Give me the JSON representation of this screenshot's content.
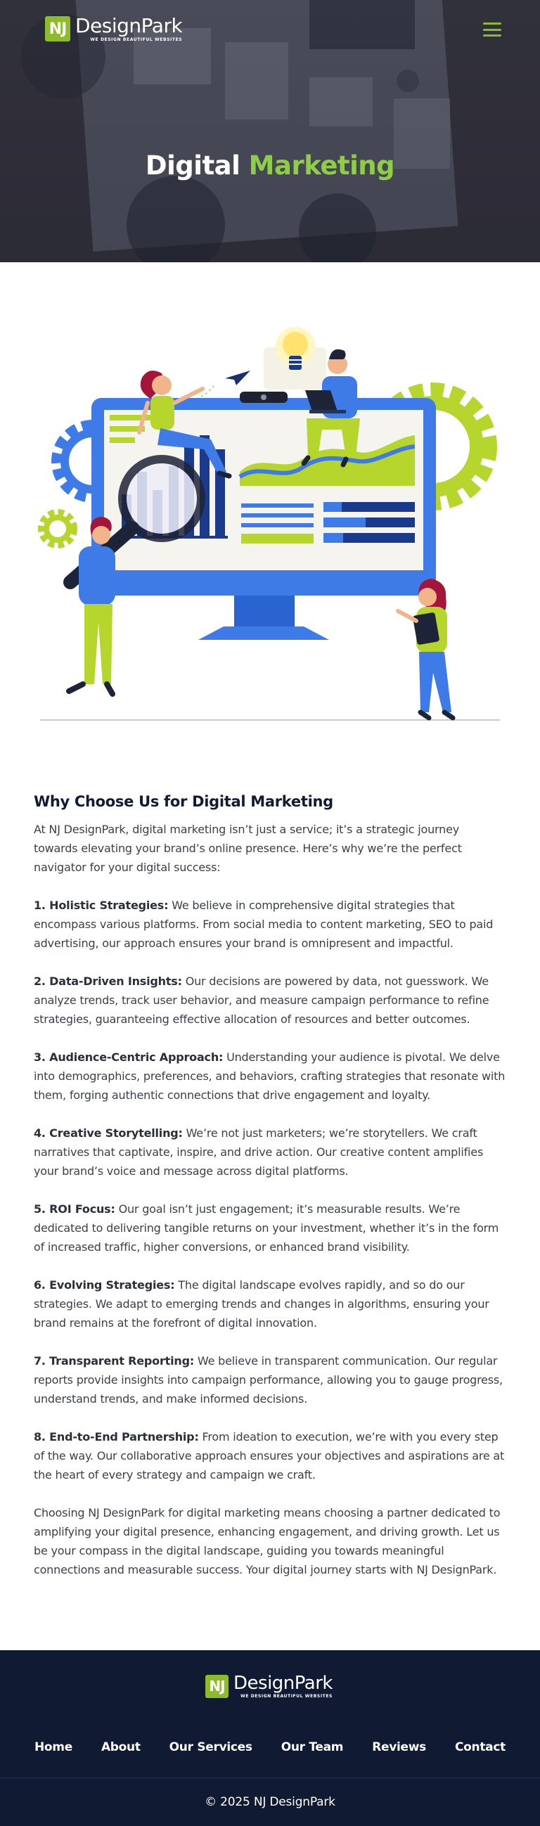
{
  "header": {
    "logo_initials": "NJ",
    "logo_name": "DesignPark",
    "logo_tagline": "WE DESIGN BEAUTIFUL WEBSITES",
    "menu_icon": "hamburger-menu-icon"
  },
  "hero": {
    "title_plain": "Digital",
    "title_accent": "Marketing"
  },
  "illustration": {
    "icons": [
      "lightbulb-icon",
      "paper-plane-icon",
      "gear-icon",
      "magnifier-icon",
      "monitor-icon",
      "laptop-icon",
      "tablet-icon"
    ]
  },
  "content": {
    "section_title": "Why Choose Us for Digital Marketing",
    "intro": "At NJ DesignPark, digital marketing isn’t just a service; it’s a strategic journey towards elevating your brand’s online presence. Here’s why we’re the perfect navigator for your digital success:",
    "points": [
      {
        "title": "1. Holistic Strategies:",
        "text": " We believe in comprehensive digital strategies that encompass various platforms. From social media to content marketing, SEO to paid advertising, our approach ensures your brand is omnipresent and impactful."
      },
      {
        "title": "2. Data-Driven Insights:",
        "text": " Our decisions are powered by data, not guesswork. We analyze trends, track user behavior, and measure campaign performance to refine strategies, guaranteeing effective allocation of resources and better outcomes."
      },
      {
        "title": "3. Audience-Centric Approach:",
        "text": " Understanding your audience is pivotal. We delve into demographics, preferences, and behaviors, crafting strategies that resonate with them, forging authentic connections that drive engagement and loyalty."
      },
      {
        "title": "4. Creative Storytelling:",
        "text": " We’re not just marketers; we’re storytellers. We craft narratives that captivate, inspire, and drive action. Our creative content amplifies your brand’s voice and message across digital platforms."
      },
      {
        "title": "5. ROI Focus:",
        "text": " Our goal isn’t just engagement; it’s measurable results. We’re dedicated to delivering tangible returns on your investment, whether it’s in the form of increased traffic, higher conversions, or enhanced brand visibility."
      },
      {
        "title": "6. Evolving Strategies:",
        "text": " The digital landscape evolves rapidly, and so do our strategies. We adapt to emerging trends and changes in algorithms, ensuring your brand remains at the forefront of digital innovation."
      },
      {
        "title": "7. Transparent Reporting:",
        "text": " We believe in transparent communication. Our regular reports provide insights into campaign performance, allowing you to gauge progress, understand trends, and make informed decisions."
      },
      {
        "title": "8. End-to-End Partnership:",
        "text": " From ideation to execution, we’re with you every step of the way. Our collaborative approach ensures your objectives and aspirations are at the heart of every strategy and campaign we craft."
      }
    ],
    "closing": "Choosing NJ DesignPark for digital marketing means choosing a partner dedicated to amplifying your digital presence, enhancing engagement, and driving growth. Let us be your compass in the digital landscape, guiding you towards meaningful connections and measurable success. Your digital journey starts with NJ DesignPark."
  },
  "footer": {
    "logo_initials": "NJ",
    "logo_name": "DesignPark",
    "logo_tagline": "WE DESIGN BEAUTIFUL WEBSITES",
    "nav": [
      "Home",
      "About",
      "Our Services",
      "Our Team",
      "Reviews",
      "Contact"
    ],
    "copyright": "© 2025 NJ DesignPark"
  },
  "colors": {
    "accent_green": "#8dce45",
    "logo_green": "#8dbb2a",
    "footer_navy": "#111a33",
    "illustration_blue": "#3e7be6",
    "illustration_lime": "#b6d52d"
  }
}
